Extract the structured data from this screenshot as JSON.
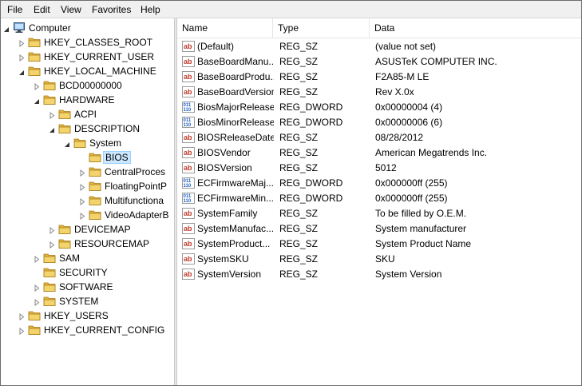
{
  "menu": [
    "File",
    "Edit",
    "View",
    "Favorites",
    "Help"
  ],
  "tree": [
    {
      "label": "Computer",
      "level": 0,
      "expanded": true,
      "icon": "computer-icon"
    },
    {
      "label": "HKEY_CLASSES_ROOT",
      "level": 1,
      "expanded": false
    },
    {
      "label": "HKEY_CURRENT_USER",
      "level": 1,
      "expanded": false
    },
    {
      "label": "HKEY_LOCAL_MACHINE",
      "level": 1,
      "expanded": true
    },
    {
      "label": "BCD00000000",
      "level": 2,
      "expanded": false
    },
    {
      "label": "HARDWARE",
      "level": 2,
      "expanded": true
    },
    {
      "label": "ACPI",
      "level": 3,
      "expanded": false
    },
    {
      "label": "DESCRIPTION",
      "level": 3,
      "expanded": true
    },
    {
      "label": "System",
      "level": 4,
      "expanded": true
    },
    {
      "label": "BIOS",
      "level": 5,
      "expanded": null,
      "selected": true
    },
    {
      "label": "CentralProces",
      "level": 5,
      "expanded": false
    },
    {
      "label": "FloatingPointP",
      "level": 5,
      "expanded": false
    },
    {
      "label": "Multifunctiona",
      "level": 5,
      "expanded": false
    },
    {
      "label": "VideoAdapterB",
      "level": 5,
      "expanded": false
    },
    {
      "label": "DEVICEMAP",
      "level": 3,
      "expanded": false
    },
    {
      "label": "RESOURCEMAP",
      "level": 3,
      "expanded": false
    },
    {
      "label": "SAM",
      "level": 2,
      "expanded": false
    },
    {
      "label": "SECURITY",
      "level": 2,
      "expanded": null
    },
    {
      "label": "SOFTWARE",
      "level": 2,
      "expanded": false
    },
    {
      "label": "SYSTEM",
      "level": 2,
      "expanded": false
    },
    {
      "label": "HKEY_USERS",
      "level": 1,
      "expanded": false
    },
    {
      "label": "HKEY_CURRENT_CONFIG",
      "level": 1,
      "expanded": false
    }
  ],
  "columns": [
    "Name",
    "Type",
    "Data"
  ],
  "values": [
    {
      "name": "(Default)",
      "type": "REG_SZ",
      "data": "(value not set)",
      "icon": "string-value-icon"
    },
    {
      "name": "BaseBoardManu...",
      "type": "REG_SZ",
      "data": "ASUSTeK COMPUTER INC.",
      "icon": "string-value-icon"
    },
    {
      "name": "BaseBoardProdu...",
      "type": "REG_SZ",
      "data": "F2A85-M LE",
      "icon": "string-value-icon"
    },
    {
      "name": "BaseBoardVersion",
      "type": "REG_SZ",
      "data": "Rev X.0x",
      "icon": "string-value-icon"
    },
    {
      "name": "BiosMajorRelease",
      "type": "REG_DWORD",
      "data": "0x00000004 (4)",
      "icon": "binary-value-icon"
    },
    {
      "name": "BiosMinorRelease",
      "type": "REG_DWORD",
      "data": "0x00000006 (6)",
      "icon": "binary-value-icon"
    },
    {
      "name": "BIOSReleaseDate",
      "type": "REG_SZ",
      "data": "08/28/2012",
      "icon": "string-value-icon"
    },
    {
      "name": "BIOSVendor",
      "type": "REG_SZ",
      "data": "American Megatrends Inc.",
      "icon": "string-value-icon"
    },
    {
      "name": "BIOSVersion",
      "type": "REG_SZ",
      "data": "5012",
      "icon": "string-value-icon"
    },
    {
      "name": "ECFirmwareMaj...",
      "type": "REG_DWORD",
      "data": "0x000000ff (255)",
      "icon": "binary-value-icon"
    },
    {
      "name": "ECFirmwareMin...",
      "type": "REG_DWORD",
      "data": "0x000000ff (255)",
      "icon": "binary-value-icon"
    },
    {
      "name": "SystemFamily",
      "type": "REG_SZ",
      "data": "To be filled by O.E.M.",
      "icon": "string-value-icon"
    },
    {
      "name": "SystemManufac...",
      "type": "REG_SZ",
      "data": "System manufacturer",
      "icon": "string-value-icon"
    },
    {
      "name": "SystemProduct...",
      "type": "REG_SZ",
      "data": "System Product Name",
      "icon": "string-value-icon"
    },
    {
      "name": "SystemSKU",
      "type": "REG_SZ",
      "data": "SKU",
      "icon": "string-value-icon"
    },
    {
      "name": "SystemVersion",
      "type": "REG_SZ",
      "data": "System Version",
      "icon": "string-value-icon"
    }
  ],
  "colors": {
    "selection": "#cce8ff",
    "selection_border": "#99d1ff",
    "folder": "#e8c14f",
    "string_icon": "#c0392b",
    "binary_icon": "#1f5fbf"
  }
}
